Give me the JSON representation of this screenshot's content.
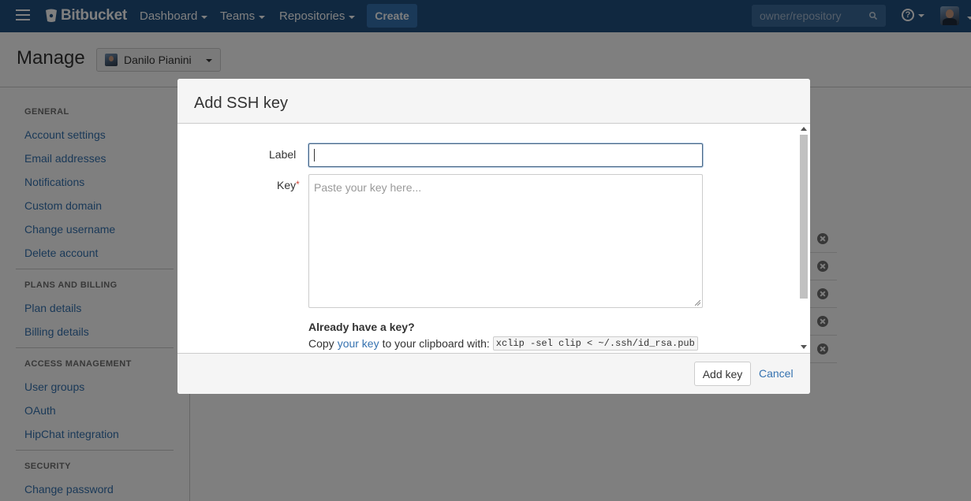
{
  "header": {
    "brand": "Bitbucket",
    "nav": [
      "Dashboard",
      "Teams",
      "Repositories"
    ],
    "create_label": "Create",
    "search_placeholder": "owner/repository",
    "help_glyph": "?",
    "bg_color": "#205081"
  },
  "page": {
    "title": "Manage",
    "account_name": "Danilo Pianini"
  },
  "sidebar": {
    "sections": [
      {
        "heading": "GENERAL",
        "items": [
          "Account settings",
          "Email addresses",
          "Notifications",
          "Custom domain",
          "Change username",
          "Delete account"
        ]
      },
      {
        "heading": "PLANS AND BILLING",
        "items": [
          "Plan details",
          "Billing details"
        ]
      },
      {
        "heading": "ACCESS MANAGEMENT",
        "items": [
          "User groups",
          "OAuth",
          "HipChat integration"
        ]
      },
      {
        "heading": "SECURITY",
        "items": [
          "Change password"
        ]
      }
    ]
  },
  "modal": {
    "title": "Add SSH key",
    "label_field": "Label",
    "label_value": "",
    "key_field": "Key",
    "required_mark": "*",
    "key_placeholder": "Paste your key here...",
    "have_key_heading": "Already have a key?",
    "copy_prefix": "Copy",
    "copy_link": "your key",
    "copy_suffix": "to your clipboard with:",
    "copy_command": "xclip -sel clip < ~/.ssh/id_rsa.pub",
    "primary_button": "Add key",
    "cancel_link": "Cancel"
  },
  "colors": {
    "link": "#3572b0",
    "required": "#d04437"
  }
}
